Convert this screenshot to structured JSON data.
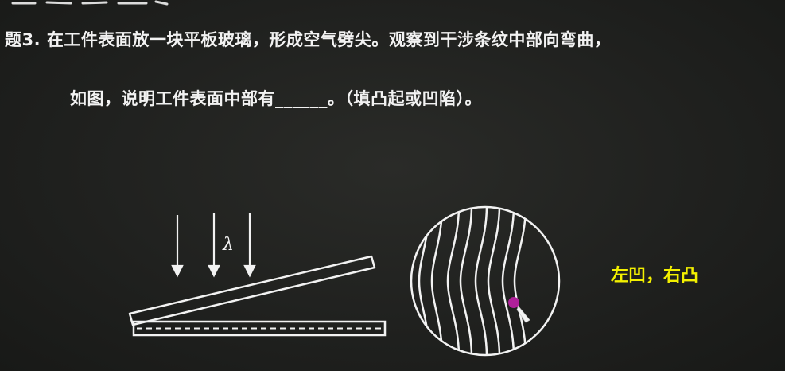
{
  "question": {
    "line1": "题3. 在工件表面放一块平板玻璃，形成空气劈尖。观察到干涉条纹中部向弯曲，",
    "line2": "如图，说明工件表面中部有______。（填凸起或凹陷）。"
  },
  "figure": {
    "wavelength_label": "λ"
  },
  "answer_note": "左凹，右凸",
  "colors": {
    "chalk": "#f2f2f2",
    "answer": "#f3f000",
    "pointer": "#b0209a"
  }
}
